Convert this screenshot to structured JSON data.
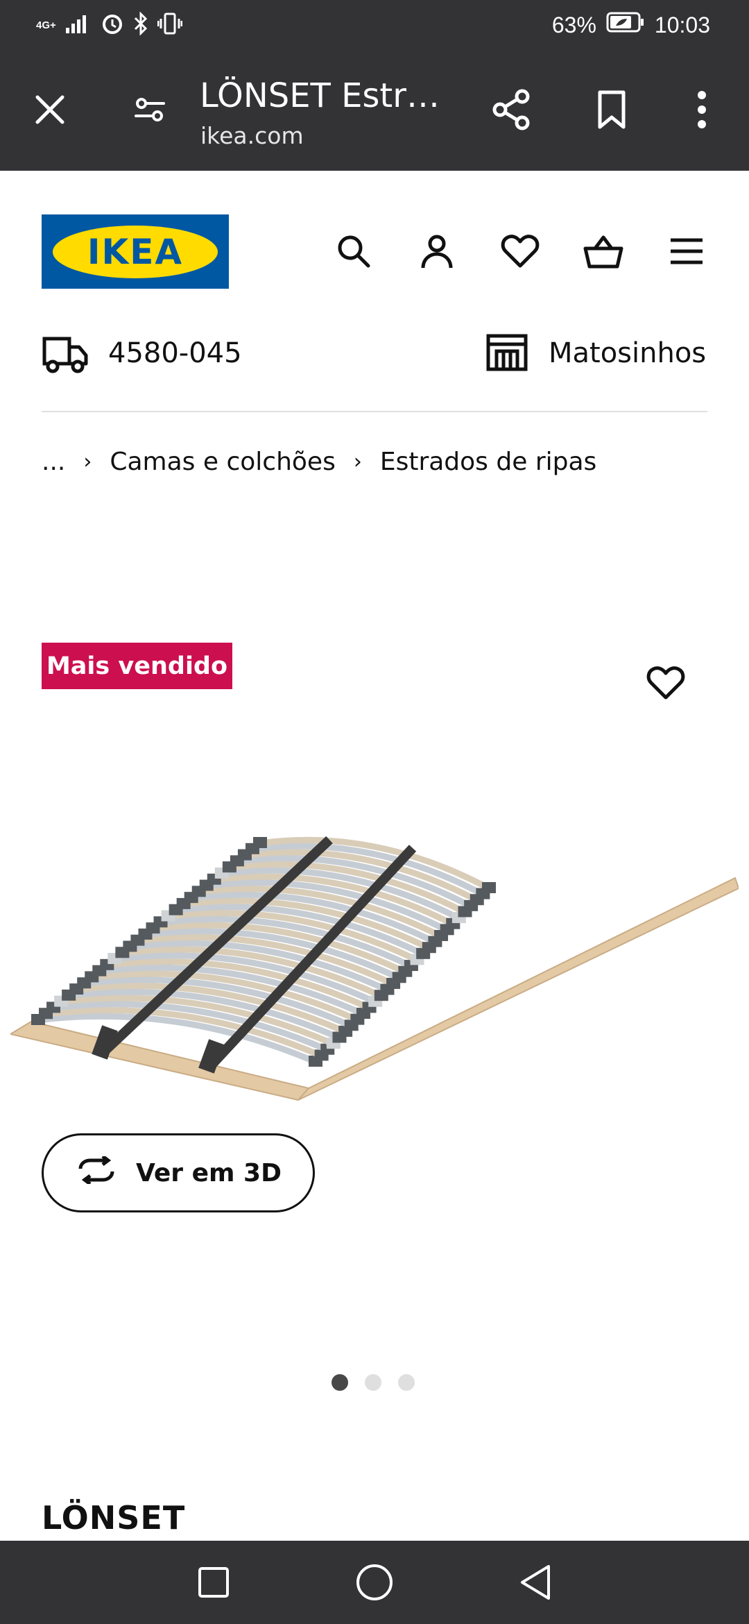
{
  "status_bar": {
    "network_label": "4G+",
    "battery_percent": "63%",
    "time": "10:03",
    "icons": [
      "signal-icon",
      "alarm-icon",
      "bluetooth-icon",
      "vibrate-icon",
      "battery-icon"
    ]
  },
  "browser": {
    "tab_title": "LÖNSET Estra…",
    "url": "ikea.com",
    "icons": [
      "close-icon",
      "site-settings-icon",
      "share-icon",
      "bookmark-icon",
      "more-icon"
    ]
  },
  "header": {
    "logo_text": "IKEA",
    "icons": [
      "search-icon",
      "account-icon",
      "wishlist-icon",
      "cart-icon",
      "menu-icon"
    ],
    "postal_code": "4580-045",
    "store": "Matosinhos"
  },
  "breadcrumb": {
    "items": [
      "...",
      "Camas e colchões",
      "Estrados de ripas"
    ]
  },
  "product": {
    "badge": "Mais vendido",
    "view_3d_label": "Ver em 3D",
    "name": "LÖNSET",
    "image_count": 3,
    "active_image_index": 0
  },
  "colors": {
    "system_bar": "#333336",
    "ikea_blue": "#0058a3",
    "ikea_yellow": "#ffdb00",
    "badge_red": "#cc0f4e"
  },
  "system_nav": {
    "icons": [
      "recents-icon",
      "home-icon",
      "back-icon"
    ]
  }
}
